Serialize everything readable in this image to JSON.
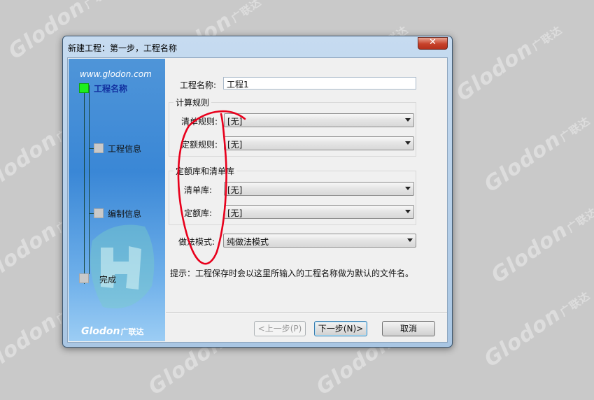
{
  "watermark": {
    "brand": "Glodon",
    "brand_cn": "广联达"
  },
  "window": {
    "title": "新建工程：第一步，工程名称",
    "close_label": "✕"
  },
  "banner": {
    "url": "www.glodon.com",
    "logo": "Glodon",
    "logo_cn": "广联达",
    "steps": [
      {
        "label": "工程名称",
        "active": true
      },
      {
        "label": "工程信息",
        "active": false
      },
      {
        "label": "编制信息",
        "active": false
      },
      {
        "label": "完成",
        "active": false
      }
    ]
  },
  "form": {
    "project_name_label": "工程名称:",
    "project_name_value": "工程1",
    "calc_rules": {
      "title": "计算规则",
      "bill_rule_label": "清单规则:",
      "bill_rule_value": "[无]",
      "quota_rule_label": "定额规则:",
      "quota_rule_value": "[无]"
    },
    "libraries": {
      "title": "定额库和清单库",
      "bill_lib_label": "清单库:",
      "bill_lib_value": "[无]",
      "quota_lib_label": "定额库:",
      "quota_lib_value": "[无]"
    },
    "method_label": "做法模式:",
    "method_value": "纯做法模式",
    "hint": "提示：工程保存时会以这里所输入的工程名称做为默认的文件名。"
  },
  "buttons": {
    "prev": "<上一步(P)",
    "next": "下一步(N)>",
    "cancel": "取消"
  },
  "colors": {
    "desktop": "#c9c9c9",
    "banner_blue": "#3a87d6",
    "active_step": "#1df01d",
    "annotation_red": "#e8001c"
  }
}
